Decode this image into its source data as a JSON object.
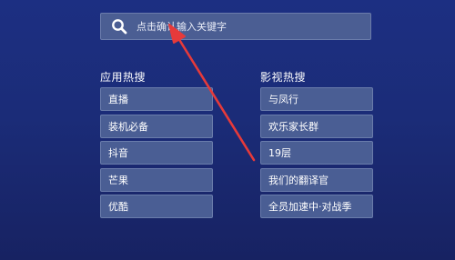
{
  "search": {
    "placeholder": "点击确认输入关键字",
    "icon": "search-icon"
  },
  "apps_section": {
    "title": "应用热搜",
    "items": [
      {
        "label": "直播"
      },
      {
        "label": "装机必备"
      },
      {
        "label": "抖音"
      },
      {
        "label": "芒果"
      },
      {
        "label": "优酷"
      }
    ]
  },
  "video_section": {
    "title": "影视热搜",
    "items": [
      {
        "label": "与凤行"
      },
      {
        "label": "欢乐家长群"
      },
      {
        "label": "19层"
      },
      {
        "label": "我们的翻译官"
      },
      {
        "label": "全员加速中·对战季"
      }
    ]
  },
  "colors": {
    "background_top": "#1c2f82",
    "background_bottom": "#172262",
    "tile": "#4a5e94",
    "tile_border": "#6a7cab",
    "arrow": "#e63a3a"
  }
}
